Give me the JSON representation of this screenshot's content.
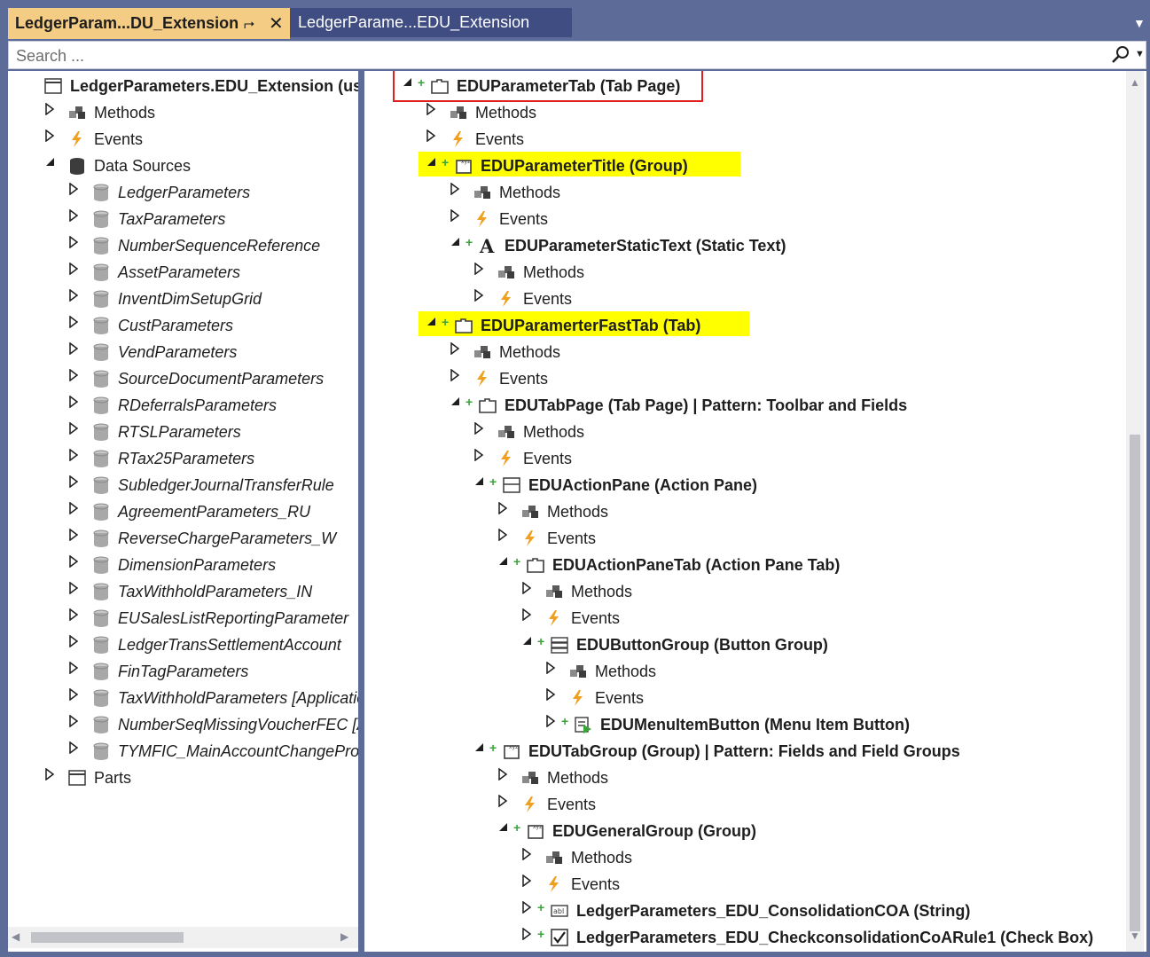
{
  "tabs": {
    "active_title": "LedgerParam...DU_Extension",
    "inactive_title": "LedgerParame...EDU_Extension"
  },
  "search": {
    "placeholder": "Search ..."
  },
  "left_tree": [
    {
      "label": "LedgerParameters.EDU_Extension (usr) [",
      "icon": "form-icon",
      "expander": "",
      "style": "b"
    },
    {
      "label": "Methods",
      "icon": "methods-icon",
      "expander": "collapsed",
      "style": ""
    },
    {
      "label": "Events",
      "icon": "events-icon",
      "expander": "collapsed",
      "style": ""
    },
    {
      "label": "Data Sources",
      "icon": "datasources-icon",
      "expander": "expanded",
      "style": ""
    },
    {
      "label": "LedgerParameters",
      "icon": "datasource-icon",
      "expander": "collapsed",
      "style": "i"
    },
    {
      "label": "TaxParameters",
      "icon": "datasource-icon",
      "expander": "collapsed",
      "style": "i"
    },
    {
      "label": "NumberSequenceReference",
      "icon": "datasource-icon",
      "expander": "collapsed",
      "style": "i"
    },
    {
      "label": "AssetParameters",
      "icon": "datasource-icon",
      "expander": "collapsed",
      "style": "i"
    },
    {
      "label": "InventDimSetupGrid",
      "icon": "datasource-icon",
      "expander": "collapsed",
      "style": "i"
    },
    {
      "label": "CustParameters",
      "icon": "datasource-icon",
      "expander": "collapsed",
      "style": "i"
    },
    {
      "label": "VendParameters",
      "icon": "datasource-icon",
      "expander": "collapsed",
      "style": "i"
    },
    {
      "label": "SourceDocumentParameters",
      "icon": "datasource-icon",
      "expander": "collapsed",
      "style": "i"
    },
    {
      "label": "RDeferralsParameters",
      "icon": "datasource-icon",
      "expander": "collapsed",
      "style": "i"
    },
    {
      "label": "RTSLParameters",
      "icon": "datasource-icon",
      "expander": "collapsed",
      "style": "i"
    },
    {
      "label": "RTax25Parameters",
      "icon": "datasource-icon",
      "expander": "collapsed",
      "style": "i"
    },
    {
      "label": "SubledgerJournalTransferRule",
      "icon": "datasource-icon",
      "expander": "collapsed",
      "style": "i"
    },
    {
      "label": "AgreementParameters_RU",
      "icon": "datasource-icon",
      "expander": "collapsed",
      "style": "i"
    },
    {
      "label": "ReverseChargeParameters_W",
      "icon": "datasource-icon",
      "expander": "collapsed",
      "style": "i"
    },
    {
      "label": "DimensionParameters",
      "icon": "datasource-icon",
      "expander": "collapsed",
      "style": "i"
    },
    {
      "label": "TaxWithholdParameters_IN",
      "icon": "datasource-icon",
      "expander": "collapsed",
      "style": "i"
    },
    {
      "label": "EUSalesListReportingParameter",
      "icon": "datasource-icon",
      "expander": "collapsed",
      "style": "i"
    },
    {
      "label": "LedgerTransSettlementAccount",
      "icon": "datasource-icon",
      "expander": "collapsed",
      "style": "i"
    },
    {
      "label": "FinTagParameters",
      "icon": "datasource-icon",
      "expander": "collapsed",
      "style": "i"
    },
    {
      "label": "TaxWithholdParameters [Application",
      "icon": "datasource-icon",
      "expander": "collapsed",
      "style": "i"
    },
    {
      "label": "NumberSeqMissingVoucherFEC [App",
      "icon": "datasource-icon",
      "expander": "collapsed",
      "style": "i"
    },
    {
      "label": "TYMFIC_MainAccountChangePropos",
      "icon": "datasource-icon",
      "expander": "collapsed",
      "style": "i"
    },
    {
      "label": "Parts",
      "icon": "parts-icon",
      "expander": "collapsed",
      "style": ""
    }
  ],
  "right_tree": [
    {
      "label": "EDUParameterTab (Tab Page)",
      "icon": "tabpage-icon",
      "expander": "expanded",
      "plus": true,
      "style": "b",
      "mark": "red"
    },
    {
      "label": "Methods",
      "icon": "methods-icon",
      "expander": "collapsed",
      "plus": false,
      "style": ""
    },
    {
      "label": "Events",
      "icon": "events-icon",
      "expander": "collapsed",
      "plus": false,
      "style": ""
    },
    {
      "label": "EDUParameterTitle (Group)",
      "icon": "group-icon",
      "expander": "expanded",
      "plus": true,
      "style": "b",
      "mark": "yellow"
    },
    {
      "label": "Methods",
      "icon": "methods-icon",
      "expander": "collapsed",
      "plus": false,
      "style": ""
    },
    {
      "label": "Events",
      "icon": "events-icon",
      "expander": "collapsed",
      "plus": false,
      "style": ""
    },
    {
      "label": "EDUParameterStaticText (Static Text)",
      "icon": "statictext-icon",
      "expander": "expanded",
      "plus": true,
      "style": "b"
    },
    {
      "label": "Methods",
      "icon": "methods-icon",
      "expander": "collapsed",
      "plus": false,
      "style": ""
    },
    {
      "label": "Events",
      "icon": "events-icon",
      "expander": "collapsed",
      "plus": false,
      "style": ""
    },
    {
      "label": "EDUParamerterFastTab (Tab)",
      "icon": "tab-icon",
      "expander": "expanded",
      "plus": true,
      "style": "b",
      "mark": "yellow"
    },
    {
      "label": "Methods",
      "icon": "methods-icon",
      "expander": "collapsed",
      "plus": false,
      "style": ""
    },
    {
      "label": "Events",
      "icon": "events-icon",
      "expander": "collapsed",
      "plus": false,
      "style": ""
    },
    {
      "label": "EDUTabPage (Tab Page) | Pattern: Toolbar and Fields",
      "icon": "tabpage-icon",
      "expander": "expanded",
      "plus": true,
      "style": "b"
    },
    {
      "label": "Methods",
      "icon": "methods-icon",
      "expander": "collapsed",
      "plus": false,
      "style": ""
    },
    {
      "label": "Events",
      "icon": "events-icon",
      "expander": "collapsed",
      "plus": false,
      "style": ""
    },
    {
      "label": "EDUActionPane (Action Pane)",
      "icon": "actionpane-icon",
      "expander": "expanded",
      "plus": true,
      "style": "b"
    },
    {
      "label": "Methods",
      "icon": "methods-icon",
      "expander": "collapsed",
      "plus": false,
      "style": ""
    },
    {
      "label": "Events",
      "icon": "events-icon",
      "expander": "collapsed",
      "plus": false,
      "style": ""
    },
    {
      "label": "EDUActionPaneTab (Action Pane Tab)",
      "icon": "tabpage-icon",
      "expander": "expanded",
      "plus": true,
      "style": "b"
    },
    {
      "label": "Methods",
      "icon": "methods-icon",
      "expander": "collapsed",
      "plus": false,
      "style": ""
    },
    {
      "label": "Events",
      "icon": "events-icon",
      "expander": "collapsed",
      "plus": false,
      "style": ""
    },
    {
      "label": "EDUButtonGroup (Button Group)",
      "icon": "buttongroup-icon",
      "expander": "expanded",
      "plus": true,
      "style": "b"
    },
    {
      "label": "Methods",
      "icon": "methods-icon",
      "expander": "collapsed",
      "plus": false,
      "style": ""
    },
    {
      "label": "Events",
      "icon": "events-icon",
      "expander": "collapsed",
      "plus": false,
      "style": ""
    },
    {
      "label": "EDUMenuItemButton (Menu Item Button)",
      "icon": "menuitembutton-icon",
      "expander": "collapsed",
      "plus": true,
      "style": "b"
    },
    {
      "label": "EDUTabGroup (Group) | Pattern: Fields and Field Groups",
      "icon": "group-icon",
      "expander": "expanded",
      "plus": true,
      "style": "b"
    },
    {
      "label": "Methods",
      "icon": "methods-icon",
      "expander": "collapsed",
      "plus": false,
      "style": ""
    },
    {
      "label": "Events",
      "icon": "events-icon",
      "expander": "collapsed",
      "plus": false,
      "style": ""
    },
    {
      "label": "EDUGeneralGroup (Group)",
      "icon": "group-icon",
      "expander": "expanded",
      "plus": true,
      "style": "b"
    },
    {
      "label": "Methods",
      "icon": "methods-icon",
      "expander": "collapsed",
      "plus": false,
      "style": ""
    },
    {
      "label": "Events",
      "icon": "events-icon",
      "expander": "collapsed",
      "plus": false,
      "style": ""
    },
    {
      "label": "LedgerParameters_EDU_ConsolidationCOA (String)",
      "icon": "string-icon",
      "expander": "collapsed",
      "plus": true,
      "style": "b"
    },
    {
      "label": "LedgerParameters_EDU_CheckconsolidationCoARule1 (Check Box)",
      "icon": "checkbox-icon",
      "expander": "collapsed",
      "plus": true,
      "style": "b"
    }
  ],
  "colors": {
    "chrome": "#5d6b99",
    "active_tab": "#f5cc84",
    "highlight": "#ffff00",
    "red_mark": "#e02020",
    "plus_green": "#3aa33a",
    "events_orange": "#f0a020"
  }
}
